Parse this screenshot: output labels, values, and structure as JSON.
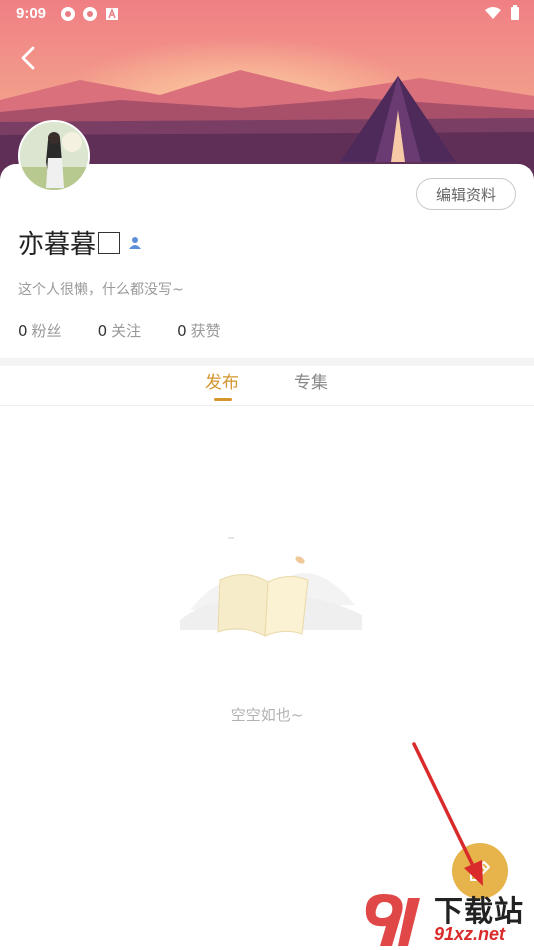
{
  "status_bar": {
    "time": "9:09"
  },
  "profile": {
    "nickname": "亦暮暮",
    "bio": "这个人很懒，什么都没写~",
    "edit_button_label": "编辑资料",
    "stats": [
      {
        "value": "0",
        "label": "粉丝"
      },
      {
        "value": "0",
        "label": "关注"
      },
      {
        "value": "0",
        "label": "获赞"
      }
    ]
  },
  "tabs": [
    {
      "label": "发布",
      "active": true
    },
    {
      "label": "专集",
      "active": false
    }
  ],
  "empty_state": {
    "text": "空空如也~"
  },
  "watermark": {
    "brand": "下载站",
    "url": "91xz.net"
  },
  "colors": {
    "accent": "#d4952d",
    "fab": "#e6b44a",
    "banner_top": "#f08e8e",
    "banner_bottom": "#6d3a63",
    "arrow": "#d92b2b"
  },
  "icons": {
    "back": "back-arrow-icon",
    "fab": "compose-icon"
  }
}
